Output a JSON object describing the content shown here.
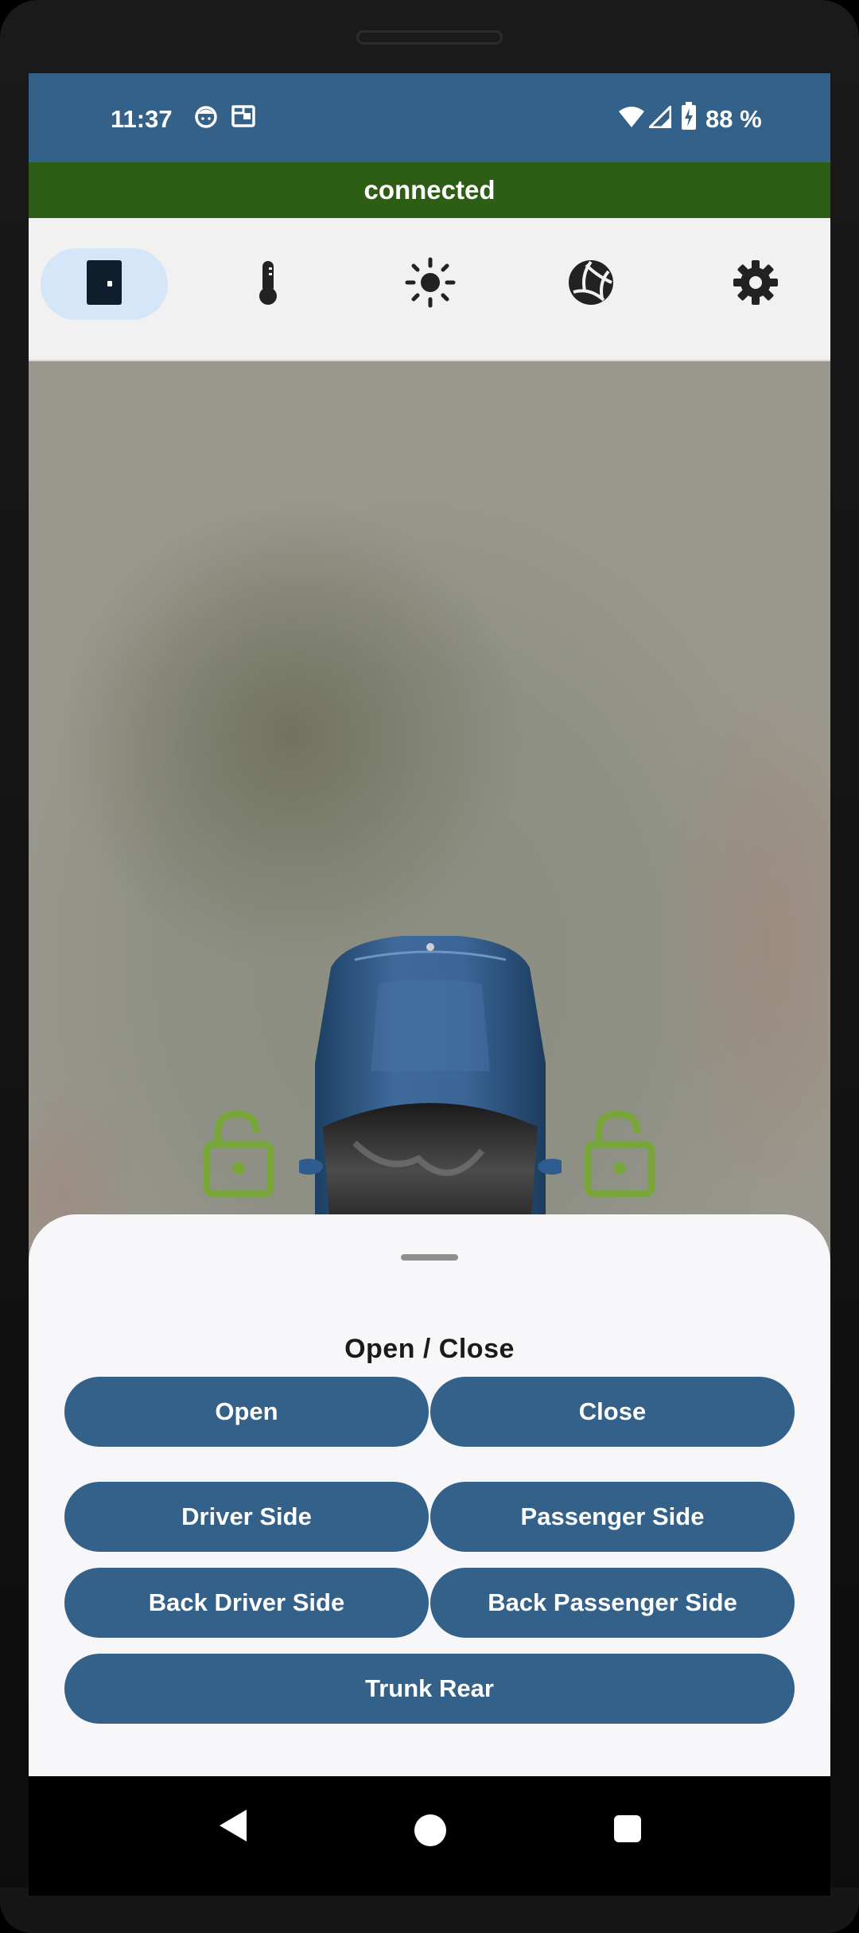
{
  "status_bar": {
    "time": "11:37",
    "battery": "88 %",
    "icons": [
      "face-icon",
      "wallet-icon",
      "wifi-icon",
      "cell-signal-icon",
      "battery-charging-icon"
    ]
  },
  "connection": {
    "status": "connected",
    "color": "#2e5e16"
  },
  "tabs": [
    {
      "name": "doors",
      "icon": "door-icon",
      "active": true
    },
    {
      "name": "climate",
      "icon": "thermometer-icon",
      "active": false
    },
    {
      "name": "lights",
      "icon": "sun-icon",
      "active": false
    },
    {
      "name": "wheels",
      "icon": "ball-icon",
      "active": false
    },
    {
      "name": "settings",
      "icon": "gear-icon",
      "active": false
    }
  ],
  "scene": {
    "locks": [
      "driver-front-lock-icon",
      "passenger-front-lock-icon",
      "driver-rear-lock-icon",
      "passenger-rear-lock-icon"
    ],
    "lock_color": "#79a63a"
  },
  "sheet": {
    "title": "Open / Close",
    "buttons": {
      "open": "Open",
      "close": "Close",
      "driver_side": "Driver Side",
      "passenger_side": "Passenger Side",
      "back_driver_side": "Back Driver Side",
      "back_passenger_side": "Back Passenger Side",
      "trunk_rear": "Trunk Rear"
    }
  },
  "colors": {
    "primary": "#33618a",
    "active_tab": "#d4e6f7"
  }
}
